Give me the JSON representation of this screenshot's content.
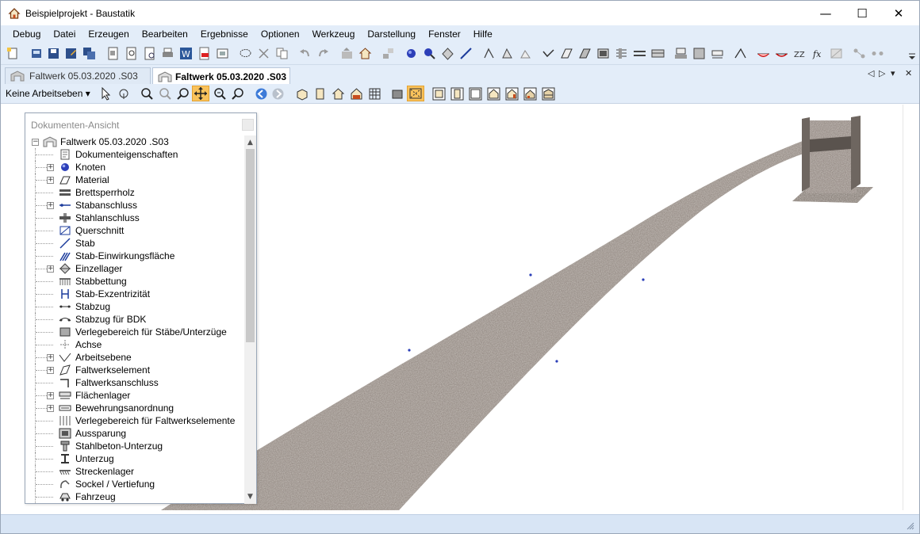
{
  "window": {
    "title": "Beispielprojekt - Baustatik",
    "minimize": "—",
    "maximize": "☐",
    "close": "✕"
  },
  "menu": [
    "Debug",
    "Datei",
    "Erzeugen",
    "Bearbeiten",
    "Ergebnisse",
    "Optionen",
    "Werkzeug",
    "Darstellung",
    "Fenster",
    "Hilfe"
  ],
  "tabs": {
    "inactive_label": "Faltwerk 05.03.2020 .S03",
    "active_label": "Faltwerk 05.03.2020 .S03",
    "nav_prev": "◁",
    "nav_next": "▷",
    "nav_menu": "▾",
    "nav_close": "✕"
  },
  "toolbar2": {
    "work_plane": "Keine Arbeitseben ▾"
  },
  "panel": {
    "title": "Dokumenten-Ansicht",
    "root": "Faltwerk 05.03.2020 .S03",
    "items": [
      {
        "label": "Dokumenteigenschaften",
        "expandable": false,
        "icon": "document-properties-icon"
      },
      {
        "label": "Knoten",
        "expandable": true,
        "icon": "node-icon"
      },
      {
        "label": "Material",
        "expandable": true,
        "icon": "material-icon"
      },
      {
        "label": "Brettsperrholz",
        "expandable": false,
        "icon": "clt-icon"
      },
      {
        "label": "Stabanschluss",
        "expandable": true,
        "icon": "member-connection-icon"
      },
      {
        "label": "Stahlanschluss",
        "expandable": false,
        "icon": "steel-connection-icon"
      },
      {
        "label": "Querschnitt",
        "expandable": false,
        "icon": "cross-section-icon"
      },
      {
        "label": "Stab",
        "expandable": false,
        "icon": "member-icon"
      },
      {
        "label": "Stab-Einwirkungsfläche",
        "expandable": false,
        "icon": "load-area-icon"
      },
      {
        "label": "Einzellager",
        "expandable": true,
        "icon": "support-icon"
      },
      {
        "label": "Stabbettung",
        "expandable": false,
        "icon": "bedding-icon"
      },
      {
        "label": "Stab-Exzentrizität",
        "expandable": false,
        "icon": "eccentricity-icon"
      },
      {
        "label": "Stabzug",
        "expandable": false,
        "icon": "member-chain-icon"
      },
      {
        "label": "Stabzug für BDK",
        "expandable": false,
        "icon": "member-chain-bdk-icon"
      },
      {
        "label": "Verlegebereich für Stäbe/Unterzüge",
        "expandable": false,
        "icon": "laying-area-icon"
      },
      {
        "label": "Achse",
        "expandable": false,
        "icon": "axis-icon"
      },
      {
        "label": "Arbeitsebene",
        "expandable": true,
        "icon": "work-plane-icon"
      },
      {
        "label": "Faltwerkselement",
        "expandable": true,
        "icon": "shell-element-icon"
      },
      {
        "label": "Faltwerksanschluss",
        "expandable": false,
        "icon": "shell-connection-icon"
      },
      {
        "label": "Flächenlager",
        "expandable": true,
        "icon": "area-support-icon"
      },
      {
        "label": "Bewehrungsanordnung",
        "expandable": true,
        "icon": "reinforcement-icon"
      },
      {
        "label": "Verlegebereich für Faltwerkselemente",
        "expandable": false,
        "icon": "shell-laying-area-icon"
      },
      {
        "label": "Aussparung",
        "expandable": false,
        "icon": "opening-icon"
      },
      {
        "label": "Stahlbeton-Unterzug",
        "expandable": false,
        "icon": "rc-beam-icon"
      },
      {
        "label": "Unterzug",
        "expandable": false,
        "icon": "beam-icon"
      },
      {
        "label": "Streckenlager",
        "expandable": false,
        "icon": "line-support-icon"
      },
      {
        "label": "Sockel / Vertiefung",
        "expandable": false,
        "icon": "pedestal-icon"
      },
      {
        "label": "Fahrzeug",
        "expandable": false,
        "icon": "vehicle-icon"
      }
    ]
  },
  "colors": {
    "chrome": "#e3edf9",
    "accent_toggle": "#f9c25b",
    "road": "#8d837c",
    "pier": "#7d736c"
  }
}
